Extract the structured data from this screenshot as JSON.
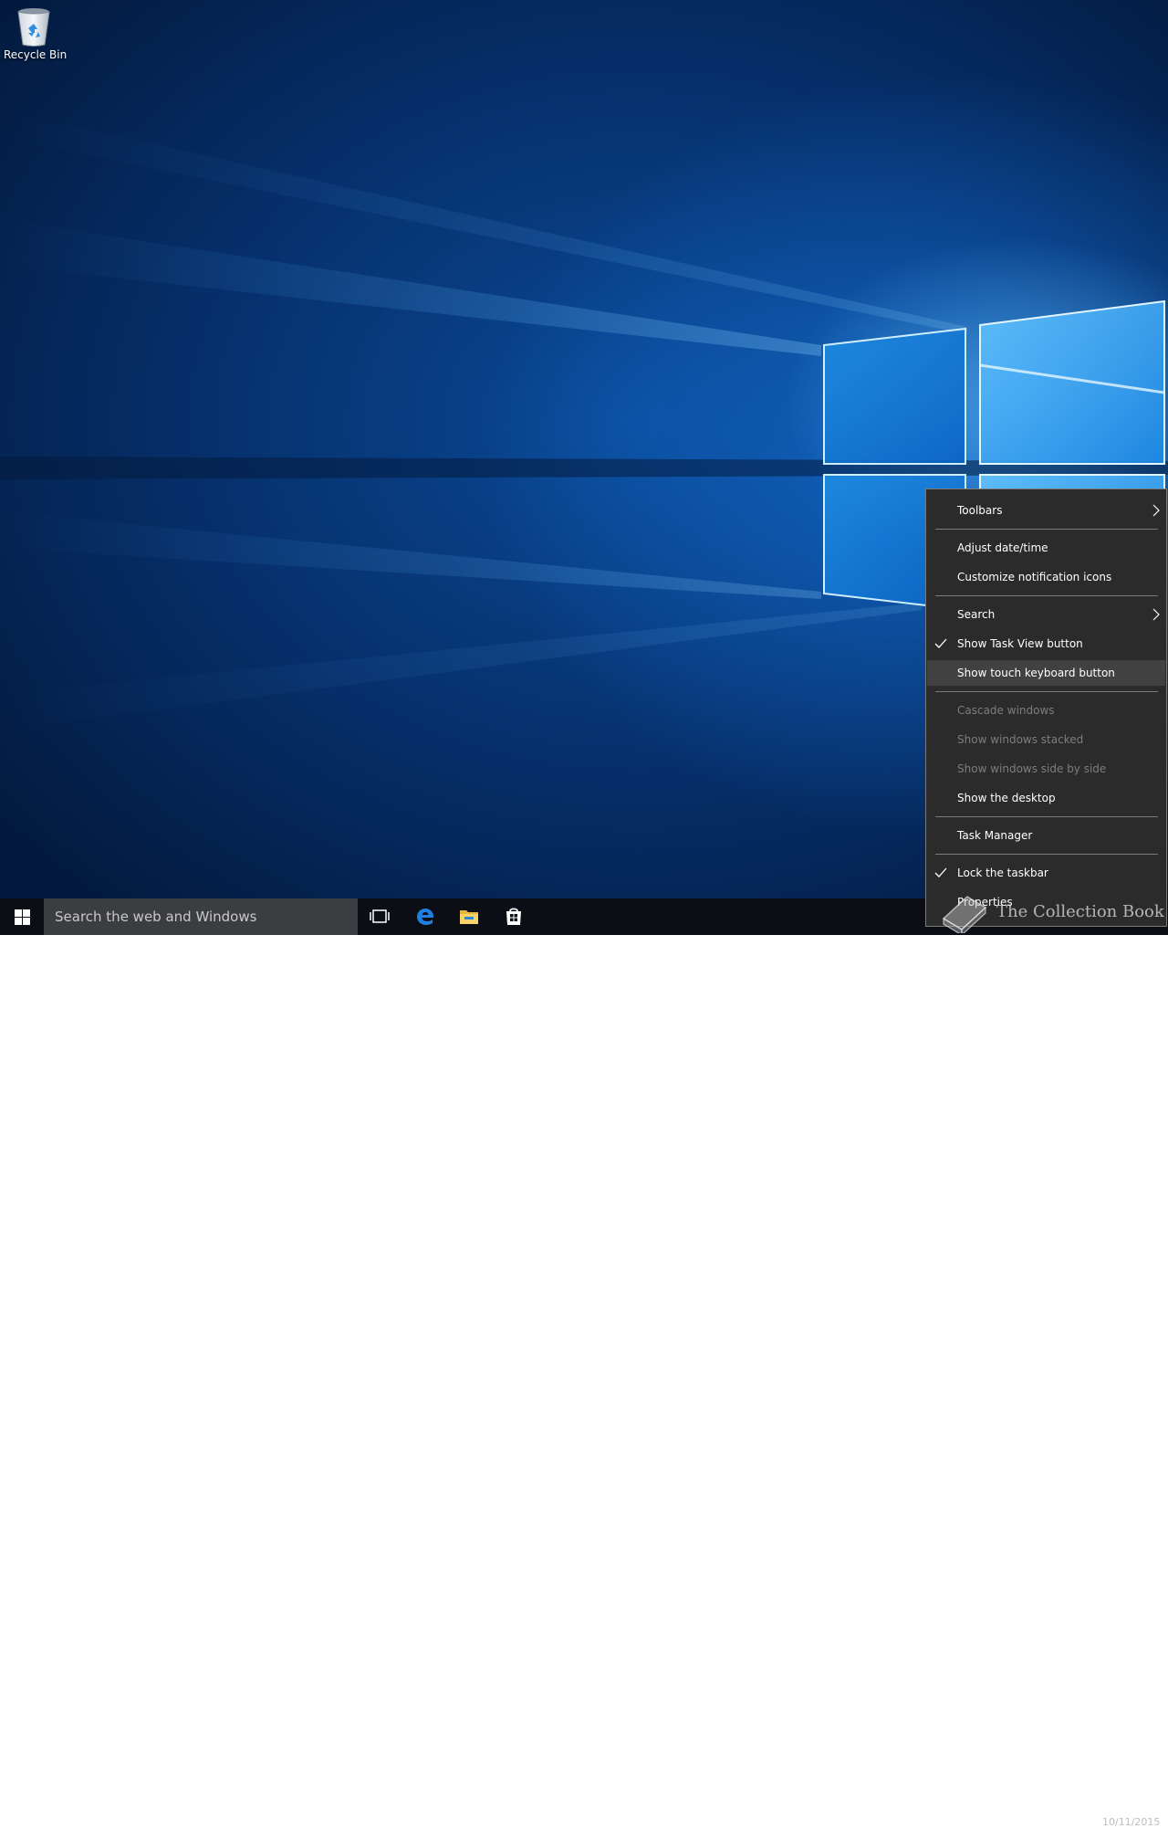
{
  "desktop": {
    "icons": [
      {
        "label": "Recycle Bin",
        "icon": "recycle-bin-icon"
      }
    ]
  },
  "taskbar": {
    "start_icon": "windows-logo-icon",
    "search_placeholder": "Search the web and Windows",
    "pinned": [
      {
        "name": "Task View",
        "icon": "task-view-icon"
      },
      {
        "name": "Microsoft Edge",
        "icon": "edge-icon"
      },
      {
        "name": "File Explorer",
        "icon": "folder-icon"
      },
      {
        "name": "Store",
        "icon": "store-icon"
      }
    ],
    "clock_partial": "10/11/2015"
  },
  "context_menu": {
    "items": [
      {
        "label": "Toolbars",
        "submenu": true
      },
      {
        "label": "Adjust date/time"
      },
      {
        "label": "Customize notification icons"
      },
      {
        "label": "Search",
        "submenu": true
      },
      {
        "label": "Show Task View button",
        "checked": true
      },
      {
        "label": "Show touch keyboard button",
        "highlighted": true
      },
      {
        "label": "Cascade windows",
        "disabled": true
      },
      {
        "label": "Show windows stacked",
        "disabled": true
      },
      {
        "label": "Show windows side by side",
        "disabled": true
      },
      {
        "label": "Show the desktop"
      },
      {
        "label": "Task Manager"
      },
      {
        "label": "Lock the taskbar",
        "checked": true
      },
      {
        "label": "Properties"
      }
    ]
  },
  "watermark": {
    "text": "The Collection Book"
  },
  "colors": {
    "menu_bg": "#2b2b2b",
    "menu_border": "#7a7a7a",
    "menu_hover": "#414141",
    "taskbar_bg": "#0b0f15",
    "search_bg": "#3b3d41",
    "accent_blue": "#0078d7"
  }
}
